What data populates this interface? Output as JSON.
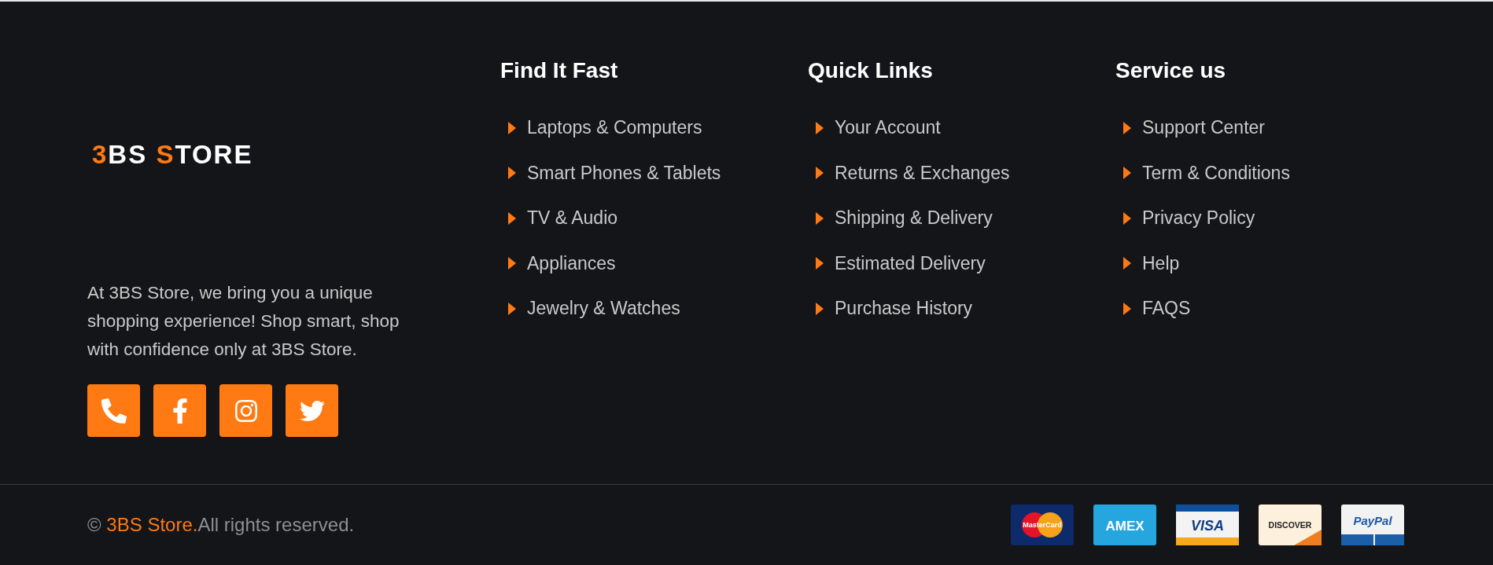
{
  "brand": {
    "logo_parts": [
      {
        "text": "3",
        "accent": true
      },
      {
        "text": "BS ",
        "accent": false
      },
      {
        "text": "S",
        "accent": true
      },
      {
        "text": "TORE",
        "accent": false
      }
    ],
    "description": "At 3BS Store, we bring you a unique shopping experience! Shop smart, shop with confidence only at 3BS Store.",
    "social": [
      {
        "kind": "phone"
      },
      {
        "kind": "facebook"
      },
      {
        "kind": "instagram"
      },
      {
        "kind": "twitter"
      }
    ]
  },
  "columns": [
    {
      "title": "Find It Fast",
      "links": [
        "Laptops & Computers",
        "Smart Phones & Tablets",
        "TV & Audio",
        "Appliances",
        "Jewelry & Watches"
      ]
    },
    {
      "title": "Quick Links",
      "links": [
        "Your Account",
        "Returns & Exchanges",
        "Shipping & Delivery",
        "Estimated Delivery",
        "Purchase History"
      ]
    },
    {
      "title": "Service us",
      "links": [
        "Support Center",
        "Term & Conditions",
        "Privacy Policy",
        "Help",
        "FAQS"
      ]
    }
  ],
  "bottom": {
    "copyright_symbol": "©",
    "store_name": "3BS Store.",
    "rights": "All rights reserved.",
    "payment_cards": [
      {
        "kind": "mastercard",
        "label": "MasterCard"
      },
      {
        "kind": "amex",
        "label": "AMEX"
      },
      {
        "kind": "visa",
        "label": "VISA"
      },
      {
        "kind": "discover",
        "label": "DISCOVER"
      },
      {
        "kind": "paypal",
        "label": "PayPal"
      }
    ]
  }
}
